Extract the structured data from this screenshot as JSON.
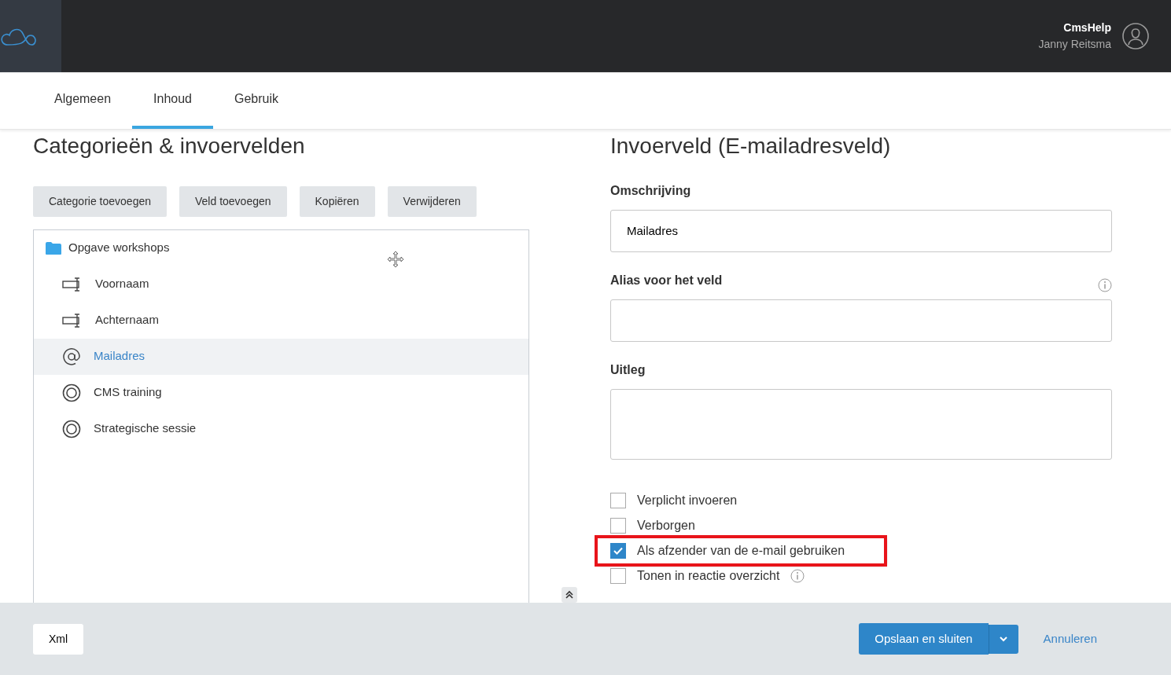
{
  "header": {
    "site": "CmsHelp",
    "user": "Janny Reitsma"
  },
  "tabs": [
    {
      "label": "Algemeen",
      "selected": false
    },
    {
      "label": "Inhoud",
      "selected": true
    },
    {
      "label": "Gebruik",
      "selected": false
    }
  ],
  "left": {
    "title": "Categorieën & invoervelden",
    "buttons": [
      "Categorie toevoegen",
      "Veld toevoegen",
      "Kopiëren",
      "Verwijderen"
    ],
    "tree": {
      "label": "Opgave workshops",
      "children": [
        {
          "label": "Voornaam",
          "kind": "text",
          "selected": false
        },
        {
          "label": "Achternaam",
          "kind": "text",
          "selected": false
        },
        {
          "label": "Mailadres",
          "kind": "email",
          "selected": true
        },
        {
          "label": "CMS training",
          "kind": "radio",
          "selected": false
        },
        {
          "label": "Strategische sessie",
          "kind": "radio",
          "selected": false
        }
      ]
    }
  },
  "right": {
    "title": "Invoerveld (E-mailadresveld)",
    "fields": [
      {
        "label": "Omschrijving",
        "value": "Mailadres",
        "kind": "input",
        "info": false
      },
      {
        "label": "Alias voor het veld",
        "kind": "input",
        "info": true
      },
      {
        "label": "Uitleg",
        "kind": "textarea",
        "info": false
      }
    ],
    "checks": [
      {
        "label": "Verplicht invoeren",
        "checked": false,
        "highlighted": false,
        "info": false
      },
      {
        "label": "Verborgen",
        "checked": false,
        "highlighted": false,
        "info": false
      },
      {
        "label": "Als afzender van de e-mail gebruiken",
        "checked": true,
        "highlighted": true,
        "info": false
      },
      {
        "label": "Tonen in reactie overzicht",
        "checked": false,
        "highlighted": false,
        "info": true
      }
    ]
  },
  "footer": {
    "left_button": "Xml",
    "save": "Opslaan en sluiten",
    "cancel": "Annuleren"
  }
}
